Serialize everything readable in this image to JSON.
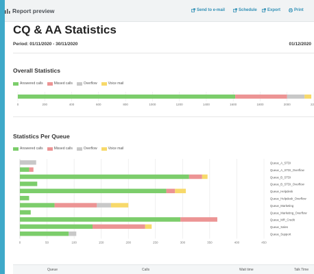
{
  "header": {
    "title": "Report preview",
    "actions": [
      {
        "label": "Send to e-mail",
        "icon": "external-link-icon"
      },
      {
        "label": "Schedule",
        "icon": "external-link-icon"
      },
      {
        "label": "Export",
        "icon": "external-link-icon"
      },
      {
        "label": "Print",
        "icon": "printer-icon"
      }
    ]
  },
  "report": {
    "title": "CQ & AA Statistics",
    "period": "Period: 01/11/2020 - 30/11/2020",
    "date": "01/12/2020"
  },
  "colors": {
    "answered": "#7ccd6b",
    "missed": "#ec9494",
    "overflow": "#c8c8c8",
    "voicemail": "#f7d96a"
  },
  "overall": {
    "title": "Overall Statistics",
    "legend": [
      "Answered calls",
      "Missed calls",
      "Overflow",
      "Voice mail"
    ]
  },
  "per_queue": {
    "title": "Statistics Per Queue",
    "legend": [
      "Answered calls",
      "Missed calls",
      "Overflow",
      "Voice mail"
    ]
  },
  "table": {
    "headers": [
      "Queue",
      "Calls",
      "Wait time",
      "Talk Time"
    ]
  },
  "chart_data": [
    {
      "type": "bar",
      "orientation": "horizontal",
      "stacked": true,
      "categories": [
        "Overall"
      ],
      "series": [
        {
          "name": "Answered calls",
          "values": [
            1615
          ]
        },
        {
          "name": "Missed calls",
          "values": [
            385
          ]
        },
        {
          "name": "Overflow",
          "values": [
            130
          ]
        },
        {
          "name": "Voice mail",
          "values": [
            50
          ]
        }
      ],
      "xticks": [
        0,
        200,
        400,
        600,
        800,
        1000,
        1200,
        1400,
        1600,
        1800,
        2000,
        2200
      ],
      "xlim": [
        0,
        2200
      ],
      "grid": true,
      "legend_position": "top-left"
    },
    {
      "type": "bar",
      "orientation": "horizontal",
      "stacked": true,
      "categories": [
        "Queue_A_STDI",
        "Queue_A_STDI_Overflow",
        "Queue_B_STDI",
        "Queue_B_STDI_Overflow",
        "Queue_Helpdesk",
        "Queue_Helpdesk_Overflow",
        "Queue_Marketing",
        "Queue_Marketing_Overflow",
        "Queue_MR_Credit",
        "Queue_Sales",
        "Queue_Support"
      ],
      "series": [
        {
          "name": "Answered calls",
          "values": [
            0,
            17,
            312,
            32,
            270,
            17,
            64,
            20,
            296,
            134,
            90
          ]
        },
        {
          "name": "Missed calls",
          "values": [
            0,
            8,
            24,
            0,
            16,
            0,
            78,
            0,
            68,
            97,
            0
          ]
        },
        {
          "name": "Overflow",
          "values": [
            30,
            0,
            0,
            0,
            0,
            0,
            26,
            0,
            0,
            0,
            14
          ]
        },
        {
          "name": "Voice mail",
          "values": [
            0,
            0,
            10,
            0,
            20,
            0,
            32,
            0,
            0,
            12,
            0
          ]
        }
      ],
      "xticks": [
        0,
        50,
        100,
        150,
        200,
        250,
        300,
        350,
        400,
        450
      ],
      "xlim": [
        0,
        450
      ],
      "grid": true,
      "legend_position": "top-left"
    }
  ]
}
